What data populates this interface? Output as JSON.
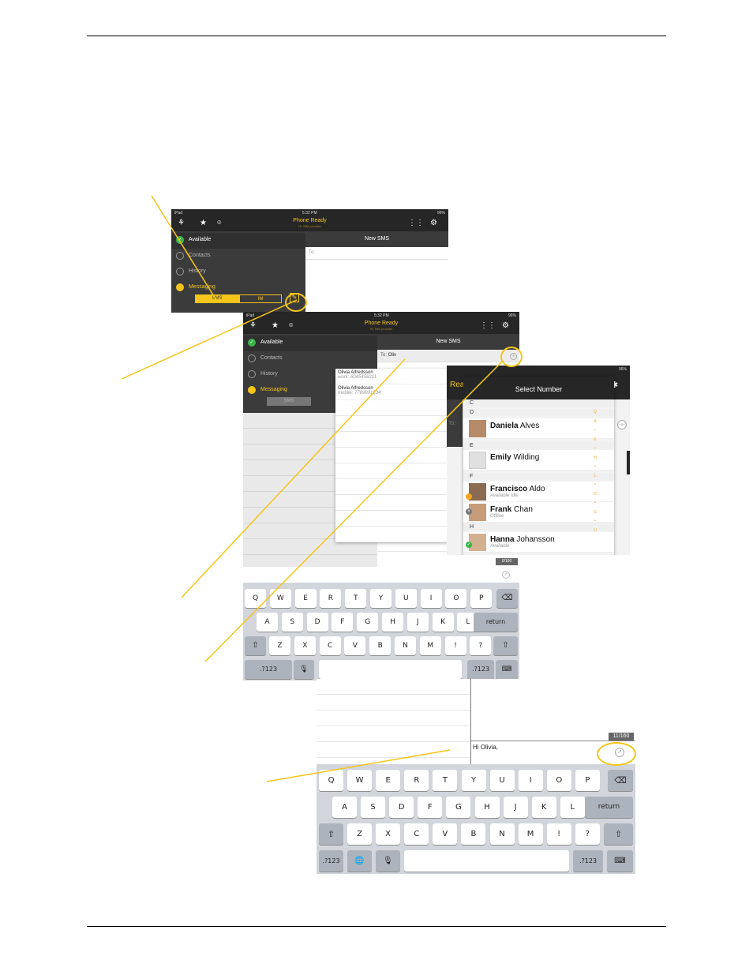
{
  "colors": {
    "accent": "#f5c51b",
    "bar": "#262626",
    "sidebar": "#3b3b3b",
    "available": "#3bb54a"
  },
  "statusbar": {
    "carrier": "iPad",
    "time": "5:32 PM",
    "battery": "96%"
  },
  "app": {
    "title": "Phone Ready",
    "subtitle": "Hi, SIM provider",
    "title_short": "Rea"
  },
  "sidebar": {
    "items": [
      {
        "label": "Available",
        "icon": "check-icon"
      },
      {
        "label": "Contacts",
        "icon": "person-icon"
      },
      {
        "label": "History",
        "icon": "clock-icon"
      },
      {
        "label": "Messaging",
        "icon": "chat-bubble-icon"
      }
    ],
    "seg_sms": "SMS",
    "seg_im": "IM"
  },
  "new_sms": {
    "header": "New SMS",
    "to_label": "To:",
    "to_value": "Oliv"
  },
  "suggestions": [
    {
      "name": "Olivia Alfredsson",
      "detail": "work: 6045458211"
    },
    {
      "name": "Olivia Alfredsson",
      "detail": "mobile: 7789891234"
    }
  ],
  "select_number": {
    "title": "Select Number",
    "sections": [
      {
        "letter": "C",
        "contacts": []
      },
      {
        "letter": "D",
        "contacts": [
          {
            "first": "Daniela",
            "last": "Alves",
            "status": ""
          }
        ]
      },
      {
        "letter": "E",
        "contacts": [
          {
            "first": "Emily",
            "last": "Wilding",
            "status": ""
          }
        ]
      },
      {
        "letter": "F",
        "contacts": [
          {
            "first": "Francisco",
            "last": "Aldo",
            "status": "Available Idle"
          },
          {
            "first": "Frank",
            "last": "Chan",
            "status": "Offline"
          }
        ]
      },
      {
        "letter": "H",
        "contacts": [
          {
            "first": "Hanna",
            "last": "Johansson",
            "status": "Available"
          }
        ]
      }
    ],
    "index": [
      "Q",
      "A",
      "•",
      "E",
      "•",
      "H",
      "•",
      "L",
      "•",
      "O",
      "•",
      "S",
      "•",
      "U"
    ]
  },
  "counter_1": "0/160",
  "counter_2": "11/160",
  "message_text": "Hi Olivia,",
  "keyboard": {
    "row1": [
      "Q",
      "W",
      "E",
      "R",
      "T",
      "Y",
      "U",
      "I",
      "O",
      "P"
    ],
    "row2": [
      "A",
      "S",
      "D",
      "F",
      "G",
      "H",
      "J",
      "K",
      "L"
    ],
    "row3": [
      "Z",
      "X",
      "C",
      "V",
      "B",
      "N",
      "M",
      "!",
      "?"
    ],
    "return": "return",
    "numbers": ".?123",
    "shift": "⇧",
    "delete": "⌫",
    "mic": "🎙",
    "globe": "🌐",
    "hide": "⌨"
  }
}
